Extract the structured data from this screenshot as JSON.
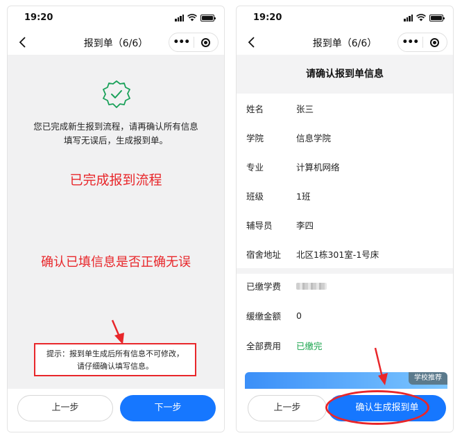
{
  "status_bar": {
    "time": "19:20"
  },
  "nav": {
    "title": "报到单（6/6）",
    "more_icon": "more-dots-icon",
    "close_icon": "mini-program-close-icon"
  },
  "left": {
    "message_line1": "您已完成新生报到流程，请再确认所有信息",
    "message_line2": "填写无误后，生成报到单。",
    "annotation_done": "已完成报到流程",
    "annotation_confirm": "确认已填信息是否正确无误",
    "tip_line1": "提示：报到单生成后所有信息不可修改，",
    "tip_line2": "请仔细确认填写信息。",
    "prev_button": "上一步",
    "next_button": "下一步"
  },
  "right": {
    "header": "请确认报到单信息",
    "fields": [
      {
        "label": "姓名",
        "value": "张三"
      },
      {
        "label": "学院",
        "value": "信息学院"
      },
      {
        "label": "专业",
        "value": "计算机网络"
      },
      {
        "label": "班级",
        "value": "1班"
      },
      {
        "label": "辅导员",
        "value": "李四"
      },
      {
        "label": "宿舍地址",
        "value": "北区1栋301室-1号床"
      }
    ],
    "fees": [
      {
        "label": "已缴学费",
        "value": ""
      },
      {
        "label": "缓缴金额",
        "value": "0"
      },
      {
        "label": "全部费用",
        "value": "已缴完"
      }
    ],
    "banner_tag": "学校推荐",
    "prev_button": "上一步",
    "generate_button": "确认生成报到单"
  },
  "colors": {
    "primary": "#1677ff",
    "annotation_red": "#e8262a",
    "success_green": "#16a34a"
  }
}
